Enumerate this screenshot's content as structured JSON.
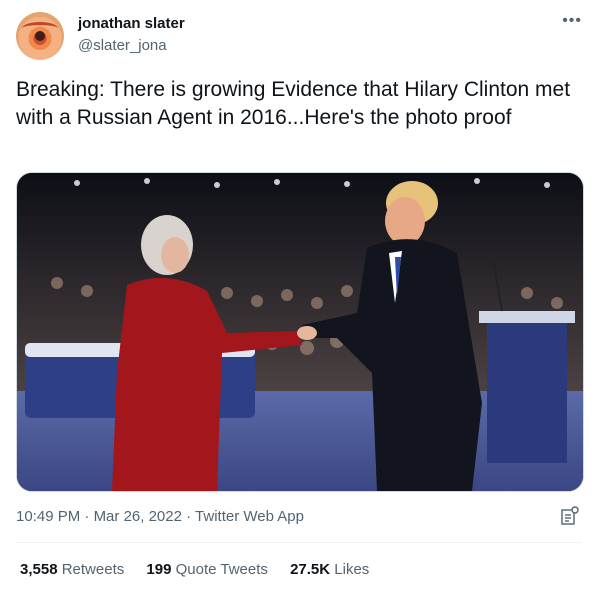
{
  "user": {
    "display_name": "jonathan slater",
    "handle": "@slater_jona",
    "avatar_icon": "eye-avatar"
  },
  "tweet": {
    "text": "Breaking: There is growing Evidence that Hilary Clinton met with a Russian Agent in 2016...Here's the photo proof",
    "media_description": "photo",
    "time": "10:49 PM",
    "date": "Mar 26, 2022",
    "source": "Twitter Web App",
    "separator": "·"
  },
  "stats": {
    "retweets_count": "3,558",
    "retweets_label": "Retweets",
    "quotes_count": "199",
    "quotes_label": "Quote Tweets",
    "likes_count": "27.5K",
    "likes_label": "Likes"
  },
  "colors": {
    "text": "#0f1419",
    "secondary": "#536471",
    "border": "#cfd9de"
  }
}
